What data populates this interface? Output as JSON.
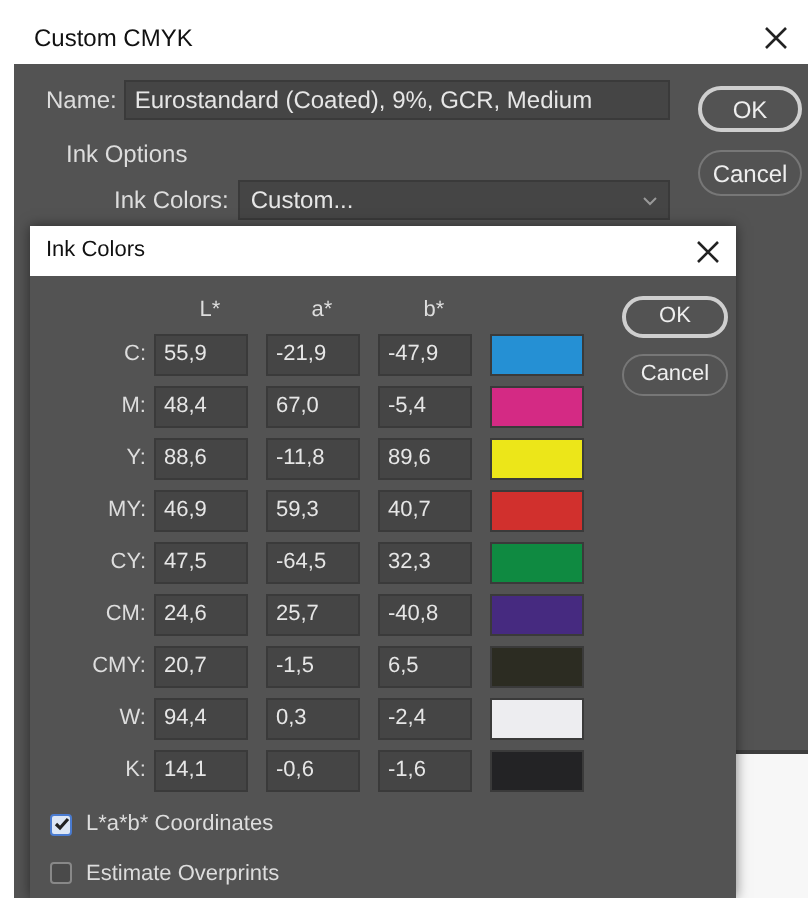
{
  "outer_dialog": {
    "title": "Custom CMYK",
    "name_label": "Name:",
    "name_value": "Eurostandard (Coated), 9%, GCR, Medium",
    "ink_options_legend": "Ink Options",
    "ink_colors_label": "Ink Colors:",
    "ink_colors_value": "Custom...",
    "buttons": [
      "OK",
      "Cancel"
    ]
  },
  "ink_dialog": {
    "title": "Ink Colors",
    "columns": [
      "L*",
      "a*",
      "b*"
    ],
    "rows": [
      {
        "label": "C:",
        "values": [
          "55,9",
          "-21,9",
          "-47,9"
        ],
        "color": "#2590d4"
      },
      {
        "label": "M:",
        "values": [
          "48,4",
          "67,0",
          "-5,4"
        ],
        "color": "#d42a84"
      },
      {
        "label": "Y:",
        "values": [
          "88,6",
          "-11,8",
          "89,6"
        ],
        "color": "#ece619"
      },
      {
        "label": "MY:",
        "values": [
          "46,9",
          "59,3",
          "40,7"
        ],
        "color": "#d1302d"
      },
      {
        "label": "CY:",
        "values": [
          "47,5",
          "-64,5",
          "32,3"
        ],
        "color": "#0f8a41"
      },
      {
        "label": "CM:",
        "values": [
          "24,6",
          "25,7",
          "-40,8"
        ],
        "color": "#462a80"
      },
      {
        "label": "CMY:",
        "values": [
          "20,7",
          "-1,5",
          "6,5"
        ],
        "color": "#2c2c22"
      },
      {
        "label": "W:",
        "values": [
          "94,4",
          "0,3",
          "-2,4"
        ],
        "color": "#ededf0"
      },
      {
        "label": "K:",
        "values": [
          "14,1",
          "-0,6",
          "-1,6"
        ],
        "color": "#232325"
      }
    ],
    "buttons": [
      "OK",
      "Cancel"
    ],
    "checkboxes": [
      {
        "label": "L*a*b* Coordinates",
        "checked": true
      },
      {
        "label": "Estimate Overprints",
        "checked": false
      }
    ]
  }
}
